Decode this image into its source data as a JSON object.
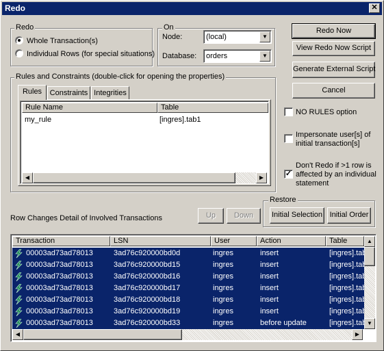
{
  "window": {
    "title": "Redo",
    "close_glyph": "✕"
  },
  "redo_group": {
    "label": "Redo",
    "options": [
      {
        "label": "Whole Transaction(s)",
        "selected": true
      },
      {
        "label": "Individual Rows (for special situations)",
        "selected": false
      }
    ]
  },
  "on_group": {
    "label": "On",
    "node_label": "Node:",
    "node_value": "(local)",
    "database_label": "Database:",
    "database_value": "orders"
  },
  "buttons": {
    "redo_now": "Redo Now",
    "view_script": "View Redo Now Script",
    "generate_external": "Generate External Script",
    "cancel": "Cancel",
    "up": "Up",
    "down": "Down",
    "initial_selection": "Initial Selection",
    "initial_order": "Initial Order"
  },
  "options": {
    "no_rules": {
      "label": "NO RULES option",
      "checked": false
    },
    "impersonate": {
      "label_line1": "Impersonate user[s] of",
      "label_line2": "initial transaction[s]",
      "checked": false
    },
    "dont_redo": {
      "label_line1": "Don't Redo if >1 row is",
      "label_line2": "affected by an individual",
      "label_line3": "statement",
      "checked": true,
      "check_glyph": "✓"
    }
  },
  "rules_group": {
    "label": "Rules and Constraints (double-click for opening the properties)",
    "tabs": [
      "Rules",
      "Constraints",
      "Integrities"
    ],
    "active_tab": "Rules",
    "columns": [
      "Rule Name",
      "Table"
    ],
    "rows": [
      {
        "rule_name": "my_rule",
        "table": "[ingres].tab1"
      }
    ]
  },
  "restore_group": {
    "label": "Restore"
  },
  "row_changes_label": "Row Changes Detail of Involved Transactions",
  "transactions": {
    "columns": [
      "Transaction",
      "LSN",
      "User",
      "Action",
      "Table"
    ],
    "rows": [
      {
        "transaction": "00003ad73ad78013",
        "lsn": "3ad76c920000bd0d",
        "user": "ingres",
        "action": "insert",
        "table": "[ingres].tab"
      },
      {
        "transaction": "00003ad73ad78013",
        "lsn": "3ad76c920000bd15",
        "user": "ingres",
        "action": "insert",
        "table": "[ingres].tab"
      },
      {
        "transaction": "00003ad73ad78013",
        "lsn": "3ad76c920000bd16",
        "user": "ingres",
        "action": "insert",
        "table": "[ingres].tab"
      },
      {
        "transaction": "00003ad73ad78013",
        "lsn": "3ad76c920000bd17",
        "user": "ingres",
        "action": "insert",
        "table": "[ingres].tab"
      },
      {
        "transaction": "00003ad73ad78013",
        "lsn": "3ad76c920000bd18",
        "user": "ingres",
        "action": "insert",
        "table": "[ingres].tab"
      },
      {
        "transaction": "00003ad73ad78013",
        "lsn": "3ad76c920000bd19",
        "user": "ingres",
        "action": "insert",
        "table": "[ingres].tab"
      },
      {
        "transaction": "00003ad73ad78013",
        "lsn": "3ad76c920000bd33",
        "user": "ingres",
        "action": "before update",
        "table": "[ingres].tab"
      }
    ]
  },
  "icons": {
    "row_icon": "lightning-icon",
    "arrow_up": "▲",
    "arrow_down": "▼",
    "arrow_left": "◀",
    "arrow_right": "▶"
  },
  "colors": {
    "selection": "#0a246a",
    "face": "#d4d0c8",
    "title_bar": "#0a246a"
  }
}
